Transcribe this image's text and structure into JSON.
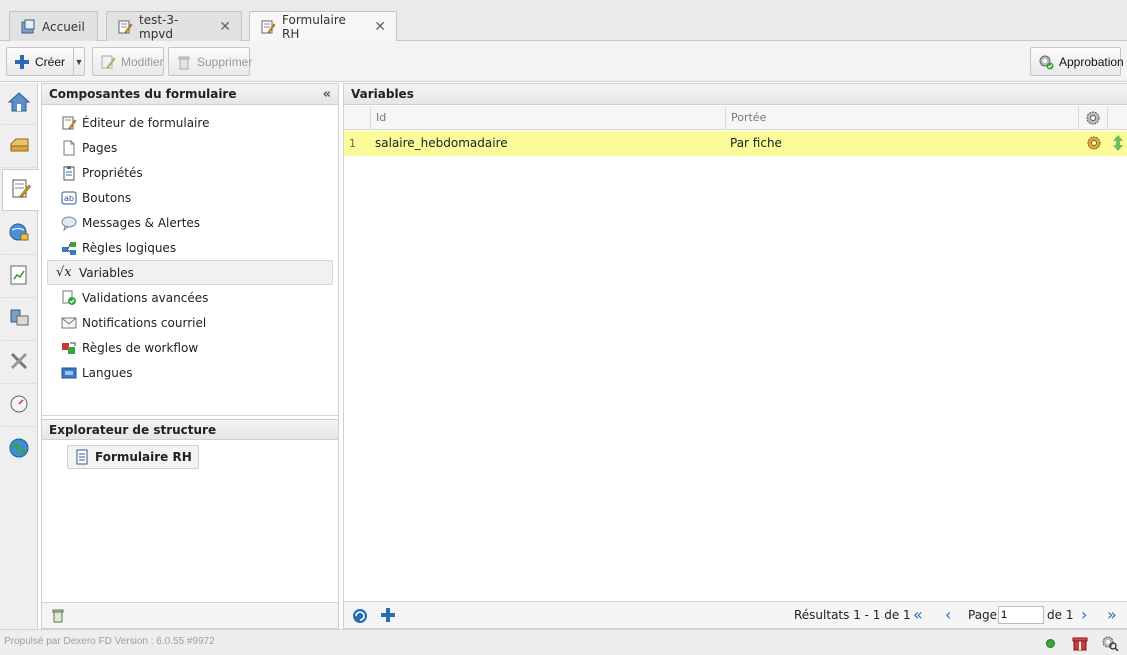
{
  "tabs": [
    {
      "label": "Accueil",
      "icon": "home-icon",
      "closable": false
    },
    {
      "label": "test-3-mpvd",
      "icon": "form-edit-icon",
      "closable": true
    },
    {
      "label": "Formulaire RH",
      "icon": "form-edit-icon",
      "closable": true,
      "active": true
    }
  ],
  "toolbar": {
    "create_label": "Créer",
    "modify_label": "Modifier",
    "delete_label": "Supprimer",
    "approval_label": "Approbation"
  },
  "components_panel": {
    "title": "Composantes du formulaire",
    "items": [
      {
        "label": "Éditeur de formulaire",
        "icon": "form-editor-icon"
      },
      {
        "label": "Pages",
        "icon": "page-icon"
      },
      {
        "label": "Propriétés",
        "icon": "properties-icon"
      },
      {
        "label": "Boutons",
        "icon": "buttons-icon"
      },
      {
        "label": "Messages & Alertes",
        "icon": "message-icon"
      },
      {
        "label": "Règles logiques",
        "icon": "logic-rules-icon"
      },
      {
        "label": "Variables",
        "icon": "sqrt-x-icon",
        "selected": true
      },
      {
        "label": "Validations avancées",
        "icon": "validation-icon"
      },
      {
        "label": "Notifications courriel",
        "icon": "email-icon"
      },
      {
        "label": "Règles de workflow",
        "icon": "workflow-icon"
      },
      {
        "label": "Langues",
        "icon": "languages-icon"
      }
    ]
  },
  "explorer": {
    "title": "Explorateur de structure",
    "root_label": "Formulaire RH"
  },
  "variables": {
    "title": "Variables",
    "columns": [
      "Id",
      "Portée"
    ],
    "rows": [
      {
        "num": "1",
        "id": "salaire_hebdomadaire",
        "scope": "Par fiche"
      }
    ]
  },
  "pagination": {
    "results": "Résultats 1 - 1 de 1",
    "page_label": "Page",
    "page_value": "1",
    "of_label": "de 1"
  },
  "status": {
    "text": "Propulsé par Dexero FD Version : 6.0.55 #9972"
  },
  "colors": {
    "selected_row": "#fbfb9a",
    "accent_blue": "#2a6bb5"
  }
}
